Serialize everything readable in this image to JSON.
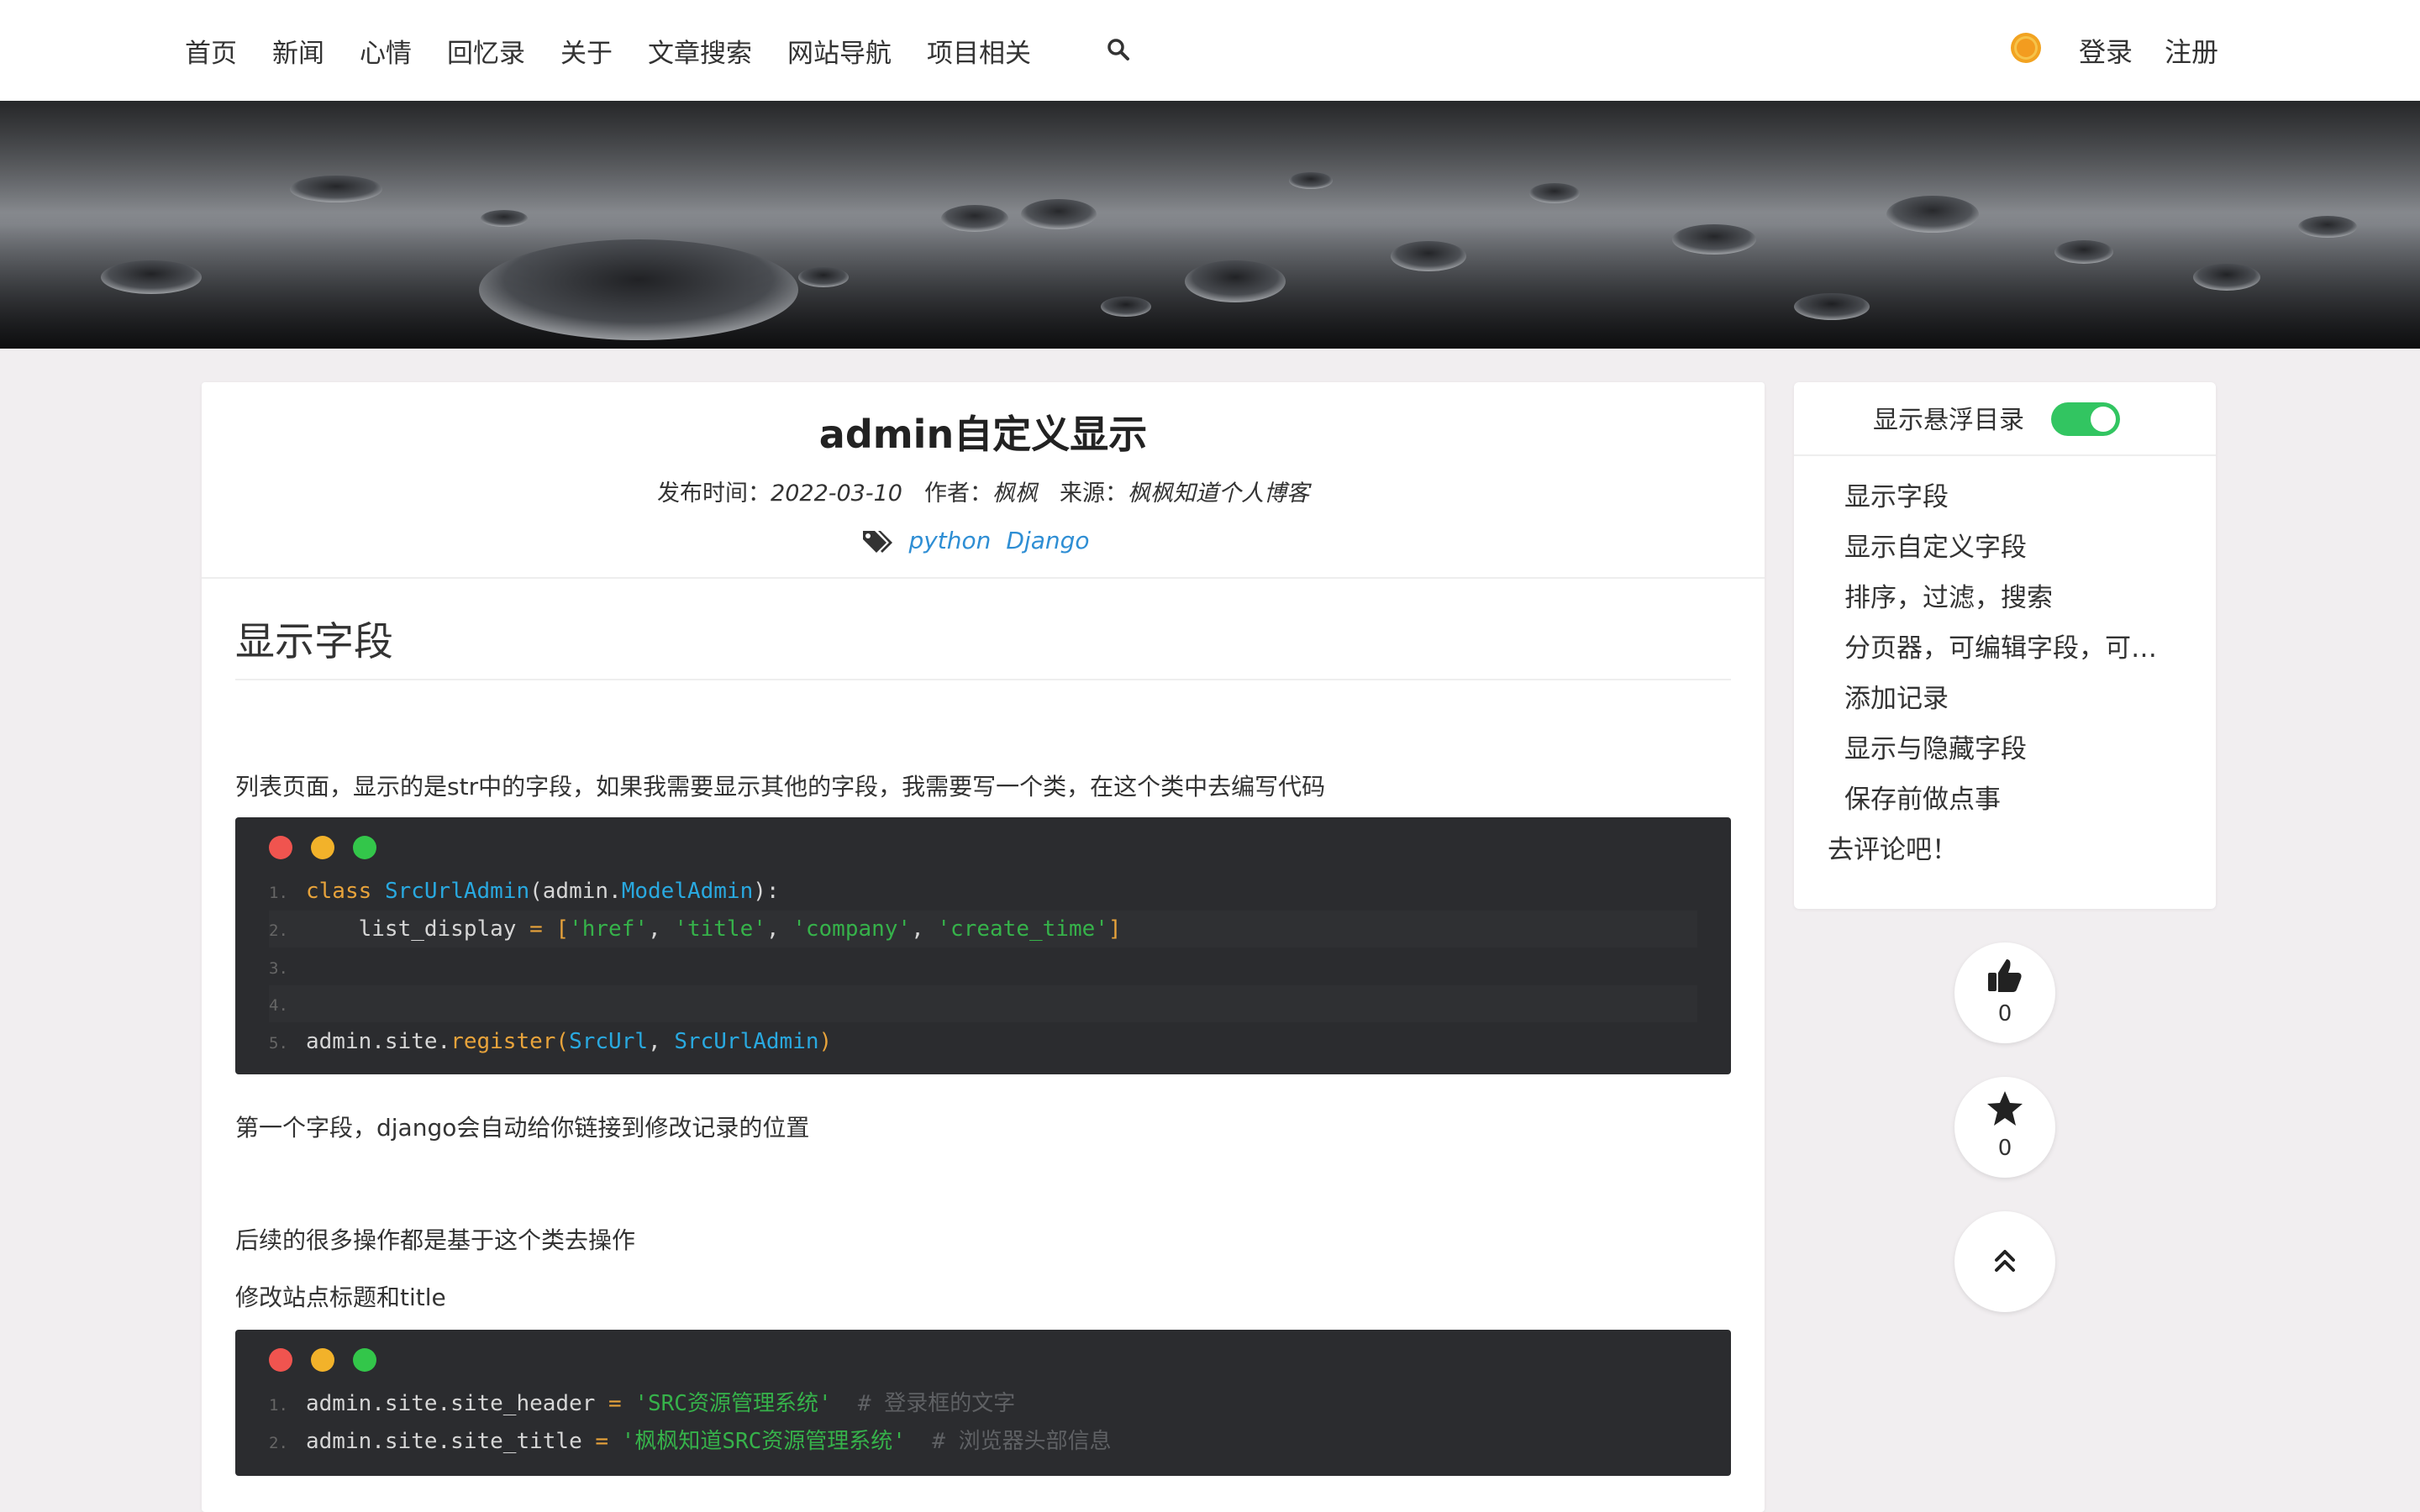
{
  "nav": {
    "items": [
      "首页",
      "新闻",
      "心情",
      "回忆录",
      "关于",
      "文章搜索",
      "网站导航",
      "项目相关"
    ],
    "login": "登录",
    "register": "注册"
  },
  "article": {
    "title": "admin自定义显示",
    "publish_label": "发布时间：",
    "publish_date": "2022-03-10",
    "author_label": "作者：",
    "author": "枫枫",
    "source_label": "来源：",
    "source": "枫枫知道个人博客",
    "tags": [
      "python",
      "Django"
    ],
    "heading": "显示字段",
    "para1": "列表页面，显示的是str中的字段，如果我需要显示其他的字段，我需要写一个类，在这个类中去编写代码",
    "para2": "第一个字段，django会自动给你链接到修改记录的位置",
    "para3": "后续的很多操作都是基于这个类去操作",
    "para4": "修改站点标题和title"
  },
  "code1": {
    "line_numbers": [
      "1.",
      "2.",
      "3.",
      "4.",
      "5."
    ],
    "l1": {
      "kw": "class",
      "cls": "SrcUrlAdmin",
      "lp": "(admin.",
      "base": "ModelAdmin",
      "rp": "):"
    },
    "l2": {
      "indent": "    list_display ",
      "eq": "=",
      "lb": " [",
      "s1": "'href'",
      "c1": ", ",
      "s2": "'title'",
      "c2": ", ",
      "s3": "'company'",
      "c3": ", ",
      "s4": "'create_time'",
      "rb": "]"
    },
    "l5": {
      "obj": "admin.site.",
      "fn": "register",
      "lp": "(",
      "a1": "SrcUrl",
      "cm": ", ",
      "a2": "SrcUrlAdmin",
      "rp": ")"
    }
  },
  "code2": {
    "line_numbers": [
      "1.",
      "2."
    ],
    "l1": {
      "lhs": "admin.site.site_header ",
      "eq": "=",
      "str": " 'SRC资源管理系统'",
      "comment": "  # 登录框的文字"
    },
    "l2": {
      "lhs": "admin.site.site_title ",
      "eq": "=",
      "str": " '枫枫知道SRC资源管理系统'",
      "comment": "  # 浏览器头部信息"
    }
  },
  "toc": {
    "toggle_label": "显示悬浮目录",
    "toggle_on": true,
    "items": [
      "显示字段",
      "显示自定义字段",
      "排序，过滤，搜索",
      "分页器，可编辑字段，可…",
      "添加记录",
      " 显示与隐藏字段",
      "保存前做点事",
      "去评论吧！"
    ]
  },
  "actions": {
    "like_count": "0",
    "star_count": "0"
  },
  "colors": {
    "accent": "#2e8ed4",
    "toggle": "#32c561",
    "code_bg": "#2b2c2f",
    "dot_red": "#f0544f",
    "dot_yellow": "#f2b22a",
    "dot_green": "#33c64a"
  }
}
